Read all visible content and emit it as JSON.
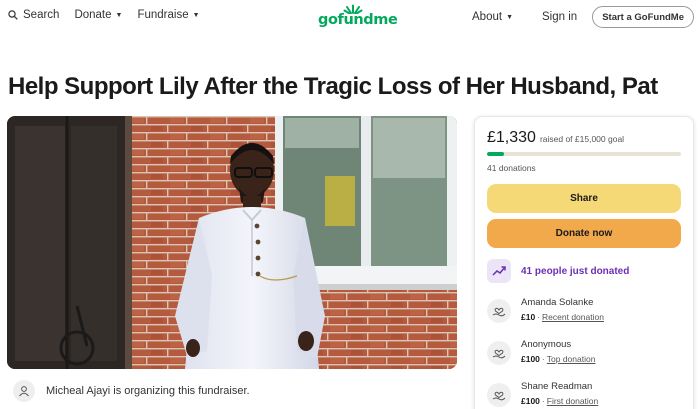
{
  "header": {
    "search_label": "Search",
    "donate_label": "Donate",
    "fundraise_label": "Fundraise",
    "logo_text": "gofundme",
    "about_label": "About",
    "signin_label": "Sign in",
    "start_label": "Start a GoFundMe"
  },
  "campaign": {
    "title": "Help Support Lily After the Tragic Loss of Her Husband, Pat",
    "organizer_text": "Micheal Ajayi is organizing this fundraiser."
  },
  "donation_card": {
    "raised_amount": "£1,330",
    "raised_label": "raised of £15,000 goal",
    "progress_fraction": 0.0887,
    "donation_count": "41 donations",
    "share_label": "Share",
    "donate_label": "Donate now",
    "recent_text": "41 people just donated",
    "donors": [
      {
        "name": "Amanda Solanke",
        "amount": "£10",
        "sep": "·",
        "tag": "Recent donation"
      },
      {
        "name": "Anonymous",
        "amount": "£100",
        "sep": "·",
        "tag": "Top donation"
      },
      {
        "name": "Shane Readman",
        "amount": "£100",
        "sep": "·",
        "tag": "First donation"
      }
    ]
  },
  "colors": {
    "brand_green": "#02a95c",
    "share_yellow": "#f6d977",
    "donate_orange": "#f1a94c",
    "trend_purple": "#6c2fb4"
  },
  "icons": [
    "search-icon",
    "caret-down-icon",
    "logo-burst-icon",
    "trend-icon",
    "heart-hand-icon",
    "user-icon"
  ]
}
